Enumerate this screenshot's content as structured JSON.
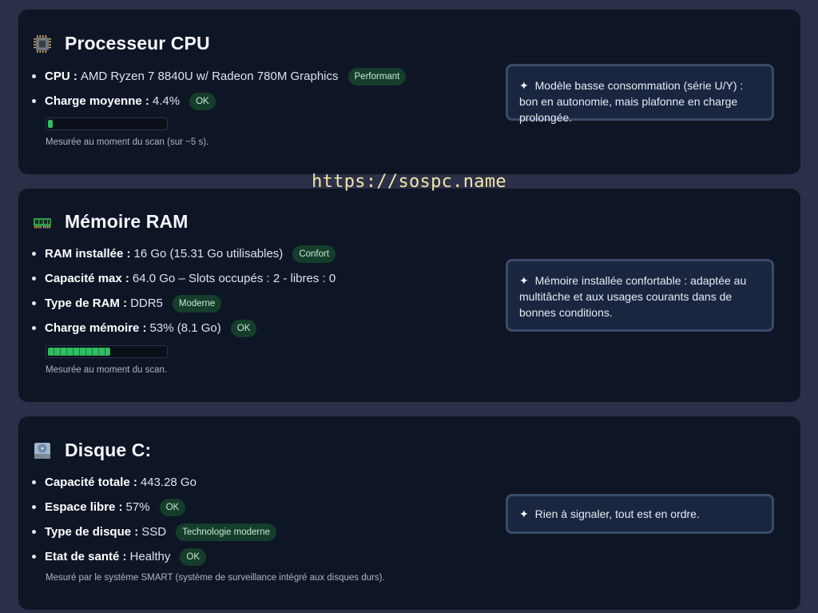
{
  "watermark": "https://sospc.name",
  "cpu": {
    "title": "Processeur CPU",
    "icon": "cpu-chip-icon",
    "items": [
      {
        "label": "CPU :",
        "value": "AMD Ryzen 7 8840U w/ Radeon 780M Graphics",
        "badge": "Performant"
      },
      {
        "label": "Charge moyenne :",
        "value": "4.4%",
        "badge": "OK"
      }
    ],
    "load_percent": 4.4,
    "note": "Mesurée au moment du scan (sur ~5 s).",
    "advice": "Modèle basse consommation (série U/Y) : bon en autonomie, mais plafonne en charge prolongée."
  },
  "ram": {
    "title": "Mémoire RAM",
    "icon": "ram-module-icon",
    "items": [
      {
        "label": "RAM installée :",
        "value": "16 Go (15.31 Go utilisables)",
        "badge": "Confort"
      },
      {
        "label": "Capacité max :",
        "value": "64.0 Go – Slots occupés : 2 - libres : 0"
      },
      {
        "label": "Type de RAM :",
        "value": "DDR5",
        "badge": "Moderne"
      },
      {
        "label": "Charge mémoire :",
        "value": "53% (8.1 Go)",
        "badge": "OK"
      }
    ],
    "load_percent": 53,
    "note": "Mesurée au moment du scan.",
    "advice": "Mémoire installée confortable : adaptée au multitâche et aux usages courants dans de bonnes conditions."
  },
  "disk": {
    "title": "Disque C:",
    "icon": "hard-disk-icon",
    "items": [
      {
        "label": "Capacité totale :",
        "value": "443.28 Go"
      },
      {
        "label": "Espace libre :",
        "value": "57%",
        "badge": "OK"
      },
      {
        "label": "Type de disque :",
        "value": "SSD",
        "badge": "Technologie moderne"
      },
      {
        "label": "Etat de santé :",
        "value": "Healthy",
        "badge": "OK"
      }
    ],
    "note": "Mesuré par le système SMART (système de surveillance intégré aux disques durs).",
    "advice": "Rien à signaler, tout est en ordre."
  },
  "advice_glyph": "✦",
  "colors": {
    "background": "#2a3048",
    "card": "#0e1626",
    "badge_bg": "#153d2b",
    "bar_fill": "#2fbd62",
    "advice_border": "#3c4a69",
    "watermark": "#f3e6a4"
  }
}
